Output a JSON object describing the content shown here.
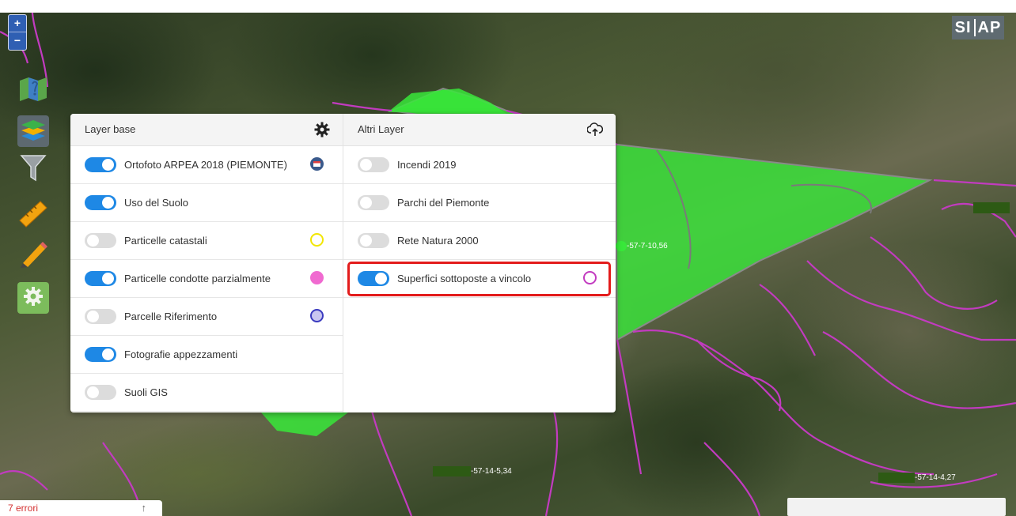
{
  "map": {
    "brand_left": "SI",
    "brand_right": "AP",
    "zoom_in": "+",
    "zoom_out": "−",
    "plot_labels": [
      "-57-7-10,56",
      "-57-14-5,34",
      "-57-14-4,27"
    ],
    "colors": {
      "selected_fill": "#38e83a",
      "parcel_border": "#c23bc0",
      "toggle_on": "#1e88e5",
      "highlight": "#e31b1b"
    }
  },
  "toolbar": {
    "tools": [
      "map-legend-icon",
      "layers-icon",
      "filter-icon",
      "ruler-icon",
      "pencil-icon",
      "settings-icon"
    ]
  },
  "layers": {
    "base": {
      "title": "Layer base",
      "items": [
        {
          "label": "Ortofoto ARPEA 2018 (PIEMONTE)",
          "on": true,
          "swatch": "calendar"
        },
        {
          "label": "Uso del Suolo",
          "on": true,
          "swatch": "none"
        },
        {
          "label": "Particelle catastali",
          "on": false,
          "swatch": "#f2e600"
        },
        {
          "label": "Particelle condotte parzialmente",
          "on": true,
          "swatch": "#f06ad0"
        },
        {
          "label": "Parcelle Riferimento",
          "on": false,
          "swatch": "#3b3bbf"
        },
        {
          "label": "Fotografie appezzamenti",
          "on": true,
          "swatch": "none"
        },
        {
          "label": "Suoli GIS",
          "on": false,
          "swatch": "none"
        }
      ]
    },
    "other": {
      "title": "Altri Layer",
      "items": [
        {
          "label": "Incendi 2019",
          "on": false,
          "swatch": "none"
        },
        {
          "label": "Parchi del Piemonte",
          "on": false,
          "swatch": "none"
        },
        {
          "label": "Rete Natura 2000",
          "on": false,
          "swatch": "none"
        },
        {
          "label": "Superfici sottoposte a vincolo",
          "on": true,
          "swatch": "#c23bc0"
        }
      ]
    }
  },
  "status": {
    "errors": "7 errori",
    "arrow": "↑"
  }
}
